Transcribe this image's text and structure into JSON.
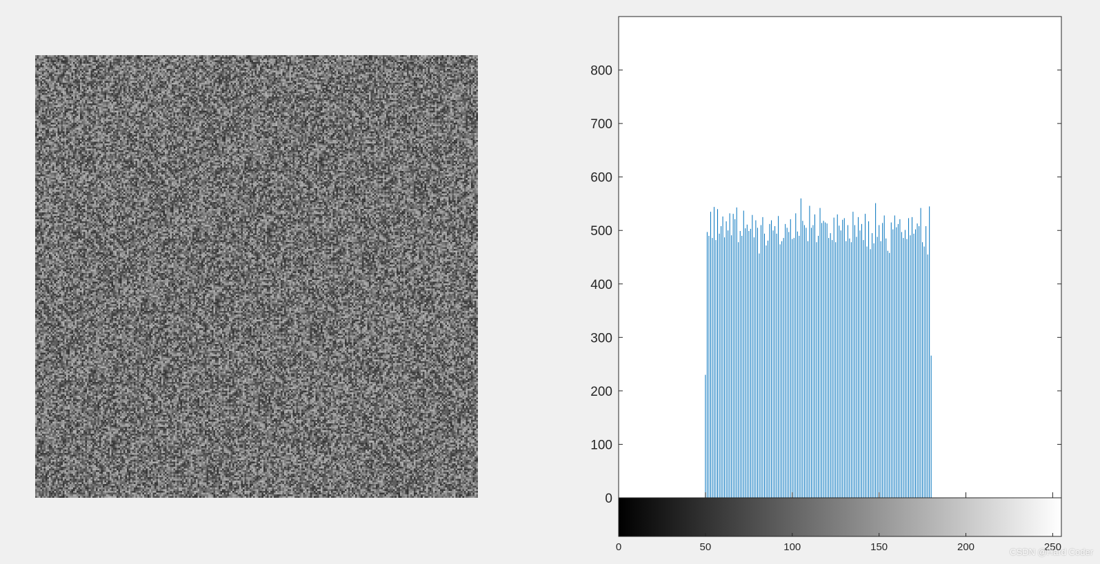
{
  "figure": {
    "background": "#f0f0f0",
    "watermark": "CSDN @Hard Coder"
  },
  "image_panel": {
    "kind": "uniform random grayscale noise",
    "pixels_per_side": 256,
    "gray_min": 50,
    "gray_max": 180
  },
  "chart_data": {
    "type": "bar",
    "title": "",
    "xlabel": "",
    "ylabel": "",
    "bar_color": "#0072bd",
    "xlim": [
      0,
      255
    ],
    "ylim": [
      0,
      900
    ],
    "yticks": [
      0,
      100,
      200,
      300,
      400,
      500,
      600,
      700,
      800
    ],
    "xticks": [
      0,
      50,
      100,
      150,
      200,
      250
    ],
    "grid": false,
    "x": [
      50,
      51,
      52,
      53,
      54,
      55,
      56,
      57,
      58,
      59,
      60,
      61,
      62,
      63,
      64,
      65,
      66,
      67,
      68,
      69,
      70,
      71,
      72,
      73,
      74,
      75,
      76,
      77,
      78,
      79,
      80,
      81,
      82,
      83,
      84,
      85,
      86,
      87,
      88,
      89,
      90,
      91,
      92,
      93,
      94,
      95,
      96,
      97,
      98,
      99,
      100,
      101,
      102,
      103,
      104,
      105,
      106,
      107,
      108,
      109,
      110,
      111,
      112,
      113,
      114,
      115,
      116,
      117,
      118,
      119,
      120,
      121,
      122,
      123,
      124,
      125,
      126,
      127,
      128,
      129,
      130,
      131,
      132,
      133,
      134,
      135,
      136,
      137,
      138,
      139,
      140,
      141,
      142,
      143,
      144,
      145,
      146,
      147,
      148,
      149,
      150,
      151,
      152,
      153,
      154,
      155,
      156,
      157,
      158,
      159,
      160,
      161,
      162,
      163,
      164,
      165,
      166,
      167,
      168,
      169,
      170,
      171,
      172,
      173,
      174,
      175,
      176,
      177,
      178,
      179,
      180
    ],
    "values": [
      230,
      497,
      490,
      535,
      486,
      544,
      482,
      540,
      494,
      508,
      526,
      487,
      517,
      500,
      532,
      491,
      531,
      521,
      543,
      478,
      499,
      490,
      537,
      504,
      511,
      499,
      503,
      529,
      487,
      519,
      505,
      457,
      510,
      525,
      494,
      472,
      481,
      512,
      519,
      500,
      508,
      494,
      527,
      474,
      480,
      486,
      512,
      505,
      497,
      521,
      484,
      486,
      532,
      498,
      490,
      560,
      518,
      510,
      505,
      480,
      546,
      505,
      510,
      530,
      478,
      490,
      542,
      514,
      518,
      515,
      513,
      486,
      495,
      482,
      524,
      478,
      530,
      509,
      500,
      520,
      523,
      480,
      510,
      485,
      478,
      535,
      510,
      488,
      525,
      500,
      512,
      482,
      531,
      470,
      517,
      465,
      495,
      476,
      551,
      488,
      510,
      480,
      514,
      528,
      485,
      462,
      458,
      515,
      502,
      528,
      506,
      512,
      521,
      497,
      486,
      501,
      484,
      523,
      491,
      525,
      494,
      502,
      513,
      508,
      542,
      478,
      470,
      508,
      455,
      545,
      266
    ],
    "colorbar": {
      "type": "gray-gradient",
      "range": [
        0,
        255
      ],
      "from_color": "#000000",
      "to_color": "#ffffff"
    }
  }
}
